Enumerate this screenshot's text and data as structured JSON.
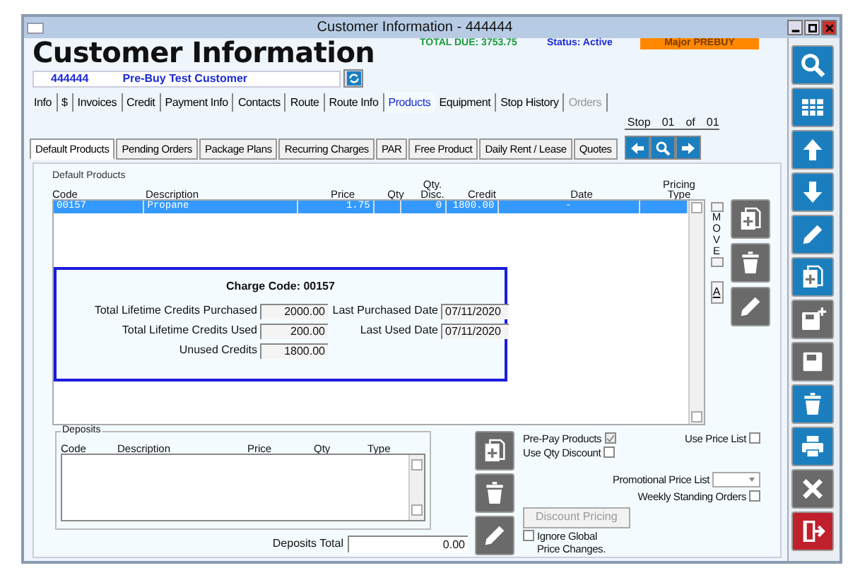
{
  "window": {
    "title": "Customer Information - 444444"
  },
  "header": {
    "title": "Customer Information",
    "total_due": "TOTAL DUE:  3753.75",
    "status": "Status: Active",
    "plan": "Major PREBUY"
  },
  "customer": {
    "number": "444444",
    "name": "Pre-Buy Test Customer"
  },
  "tabs": [
    {
      "label": "Info",
      "selected": false,
      "disabled": false
    },
    {
      "label": "$",
      "selected": false,
      "disabled": false
    },
    {
      "label": "Invoices",
      "selected": false,
      "disabled": false
    },
    {
      "label": "Credit",
      "selected": false,
      "disabled": false
    },
    {
      "label": "Payment Info",
      "selected": false,
      "disabled": false
    },
    {
      "label": "Contacts",
      "selected": false,
      "disabled": false
    },
    {
      "label": "Route",
      "selected": false,
      "disabled": false
    },
    {
      "label": "Route Info",
      "selected": false,
      "disabled": false
    },
    {
      "label": "Products",
      "selected": true,
      "disabled": false
    },
    {
      "label": "Equipment",
      "selected": false,
      "disabled": false
    },
    {
      "label": "Stop History",
      "selected": false,
      "disabled": false
    },
    {
      "label": "Orders",
      "selected": false,
      "disabled": true
    }
  ],
  "subtabs": [
    {
      "label": "Default Products",
      "selected": true
    },
    {
      "label": "Pending Orders",
      "selected": false
    },
    {
      "label": "Package Plans",
      "selected": false
    },
    {
      "label": "Recurring Charges",
      "selected": false
    },
    {
      "label": "PAR",
      "selected": false
    },
    {
      "label": "Free Product",
      "selected": false
    },
    {
      "label": "Daily Rent / Lease",
      "selected": false
    },
    {
      "label": "Quotes",
      "selected": false
    }
  ],
  "stop": {
    "label": "Stop",
    "number": "01",
    "of": "of",
    "total": "01"
  },
  "products": {
    "caption": "Default Products",
    "columns": [
      "Code",
      "Description",
      "Price",
      "Qty",
      "Qty. Disc.",
      "Credit",
      "Date",
      "Pricing Type"
    ],
    "rows": [
      {
        "cells": [
          "00157",
          "Propane",
          "1.75",
          null,
          "0",
          "1800.00",
          "-",
          null
        ],
        "selected": true
      }
    ]
  },
  "charge": {
    "title": "Charge Code:  00157",
    "fields": [
      {
        "label": "Total Lifetime Credits Purchased",
        "value": "2000.00"
      },
      {
        "label": "Last Purchased Date",
        "value": "07/11/2020"
      },
      {
        "label": "Total Lifetime Credits Used",
        "value": "200.00"
      },
      {
        "label": "Last Used Date",
        "value": "07/11/2020"
      },
      {
        "label": "Unused Credits",
        "value": "1800.00"
      }
    ]
  },
  "move": {
    "label": "MOVE",
    "sort": "A"
  },
  "deposits": {
    "legend": "Deposits",
    "columns": [
      "Code",
      "Description",
      "Price",
      "Qty",
      "Type"
    ],
    "total_label": "Deposits Total",
    "total": "0.00"
  },
  "options": [
    {
      "kind": "checkbox",
      "label": "Pre-Pay Products",
      "checked": true
    },
    {
      "kind": "checkbox",
      "label": "Use Price List",
      "checked": false
    },
    {
      "kind": "checkbox",
      "label": "Use Qty Discount",
      "checked": false
    },
    {
      "kind": "select",
      "label": "Promotional Price List"
    },
    {
      "kind": "checkbox",
      "label": "Weekly Standing Orders",
      "checked": false
    },
    {
      "kind": "button",
      "label": "Discount Pricing",
      "disabled": true
    },
    {
      "kind": "checkbox-left",
      "label": "Ignore Global Price Changes.",
      "checked": false
    }
  ],
  "sidebar": [
    {
      "color": "#1b7fbf"
    },
    {
      "color": "#1b7fbf"
    },
    {
      "color": "#1b7fbf"
    },
    {
      "color": "#1b7fbf"
    },
    {
      "color": "#1b7fbf"
    },
    {
      "color": "#1b7fbf"
    },
    {
      "color": "#6a6a6a"
    },
    {
      "color": "#6a6a6a"
    },
    {
      "color": "#1b7fbf"
    },
    {
      "color": "#1b7fbf"
    },
    {
      "color": "#6a6a6a"
    },
    {
      "color": "#c0202c"
    }
  ]
}
